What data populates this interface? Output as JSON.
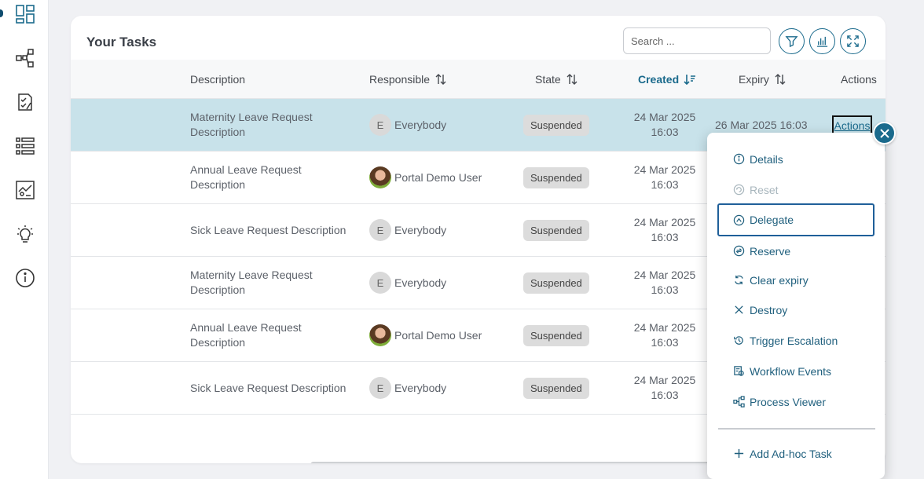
{
  "card": {
    "title": "Your Tasks",
    "search_placeholder": "Search ..."
  },
  "toolbar_icons": [
    "filter-icon",
    "chart-icon",
    "expand-icon"
  ],
  "sidebar": {
    "icons": [
      "dashboard-icon",
      "process-tree-icon",
      "task-list-icon",
      "list-icon",
      "report-icon",
      "idea-icon",
      "info-icon"
    ],
    "active_index": 0
  },
  "table": {
    "headers": {
      "description": "Description",
      "responsible": "Responsible",
      "state": "State",
      "created": "Created",
      "expiry": "Expiry",
      "actions": "Actions"
    },
    "rows": [
      {
        "desc_line1": "Maternity Leave Request",
        "desc_line2": "Description",
        "avatar": "E",
        "responsible": "Everybody",
        "state": "Suspended",
        "created_date": "24 Mar 2025",
        "created_time": "16:03",
        "expiry": "26 Mar 2025 16:03",
        "selected": true
      },
      {
        "desc_line1": "Annual Leave Request",
        "desc_line2": "Description",
        "avatar": "photo",
        "responsible": "Portal Demo User",
        "state": "Suspended",
        "created_date": "24 Mar 2025",
        "created_time": "16:03",
        "expiry": ""
      },
      {
        "desc_line1": "Sick Leave Request Description",
        "desc_line2": "",
        "avatar": "E",
        "responsible": "Everybody",
        "state": "Suspended",
        "created_date": "24 Mar 2025",
        "created_time": "16:03",
        "expiry": ""
      },
      {
        "desc_line1": "Maternity Leave Request",
        "desc_line2": "Description",
        "avatar": "E",
        "responsible": "Everybody",
        "state": "Suspended",
        "created_date": "24 Mar 2025",
        "created_time": "16:03",
        "expiry": ""
      },
      {
        "desc_line1": "Annual Leave Request",
        "desc_line2": "Description",
        "avatar": "photo",
        "responsible": "Portal Demo User",
        "state": "Suspended",
        "created_date": "24 Mar 2025",
        "created_time": "16:03",
        "expiry": ""
      },
      {
        "desc_line1": "Sick Leave Request Description",
        "desc_line2": "",
        "avatar": "E",
        "responsible": "Everybody",
        "state": "Suspended",
        "created_date": "24 Mar 2025",
        "created_time": "16:03",
        "expiry": ""
      }
    ],
    "actions_link": "Actions"
  },
  "menu": {
    "items": [
      {
        "label": "Details",
        "icon": "info-circle-icon",
        "state": "normal"
      },
      {
        "label": "Reset",
        "icon": "reset-icon",
        "state": "disabled"
      },
      {
        "label": "Delegate",
        "icon": "delegate-icon",
        "state": "focused"
      },
      {
        "label": "Reserve",
        "icon": "reserve-icon",
        "state": "normal"
      },
      {
        "label": "Clear expiry",
        "icon": "refresh-icon",
        "state": "normal"
      },
      {
        "label": "Destroy",
        "icon": "x-icon",
        "state": "normal"
      },
      {
        "label": "Trigger Escalation",
        "icon": "history-icon",
        "state": "normal"
      },
      {
        "label": "Workflow Events",
        "icon": "workflow-events-icon",
        "state": "normal"
      },
      {
        "label": "Process Viewer",
        "icon": "process-viewer-icon",
        "state": "normal"
      }
    ],
    "footer_item": {
      "label": "Add Ad-hoc Task",
      "icon": "plus-icon"
    }
  },
  "colors": {
    "accent": "#1a6a8c",
    "selected_row": "#c8e2ea",
    "badge_bg": "#dcdcdc"
  }
}
